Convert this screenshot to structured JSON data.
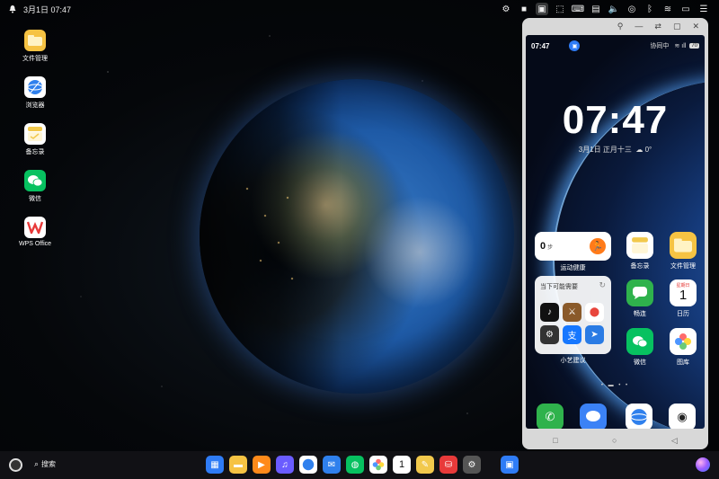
{
  "topbar": {
    "time": "3月1日 07:47"
  },
  "desktop_icons": [
    {
      "label": "文件管理",
      "icon": "folder-icon",
      "color": "#f6c343"
    },
    {
      "label": "浏览器",
      "icon": "globe-icon",
      "color": "#2f80ed"
    },
    {
      "label": "备忘录",
      "icon": "notes-icon",
      "color": "#f2c94c"
    },
    {
      "label": "微信",
      "icon": "wechat-icon",
      "color": "#07c160"
    },
    {
      "label": "WPS Office",
      "icon": "wps-icon",
      "color": "#e83a3a"
    }
  ],
  "phone": {
    "status_time": "07:47",
    "collab_text": "协同中",
    "battery": "70",
    "clock": "07:47",
    "date": "3月1日 正月十三",
    "weather": "0°",
    "steps_value": "0",
    "steps_unit": "步",
    "steps_label": "运动健康",
    "suggest_title": "当下可能需要",
    "suggest_label": "小艺建议",
    "apps": {
      "notes": "备忘录",
      "files": "文件管理",
      "messages": "畅连",
      "calendar": "日历",
      "calendar_day": "1",
      "calendar_header": "星期日",
      "wechat": "微信",
      "gallery": "图库"
    },
    "page_dots": "• ▬ • •"
  },
  "taskbar": {
    "search_label": "搜索",
    "calendar_day": "1"
  },
  "colors": {
    "accent": "#2f7cf6",
    "wechat": "#07c160",
    "taskbar": "#121216"
  }
}
